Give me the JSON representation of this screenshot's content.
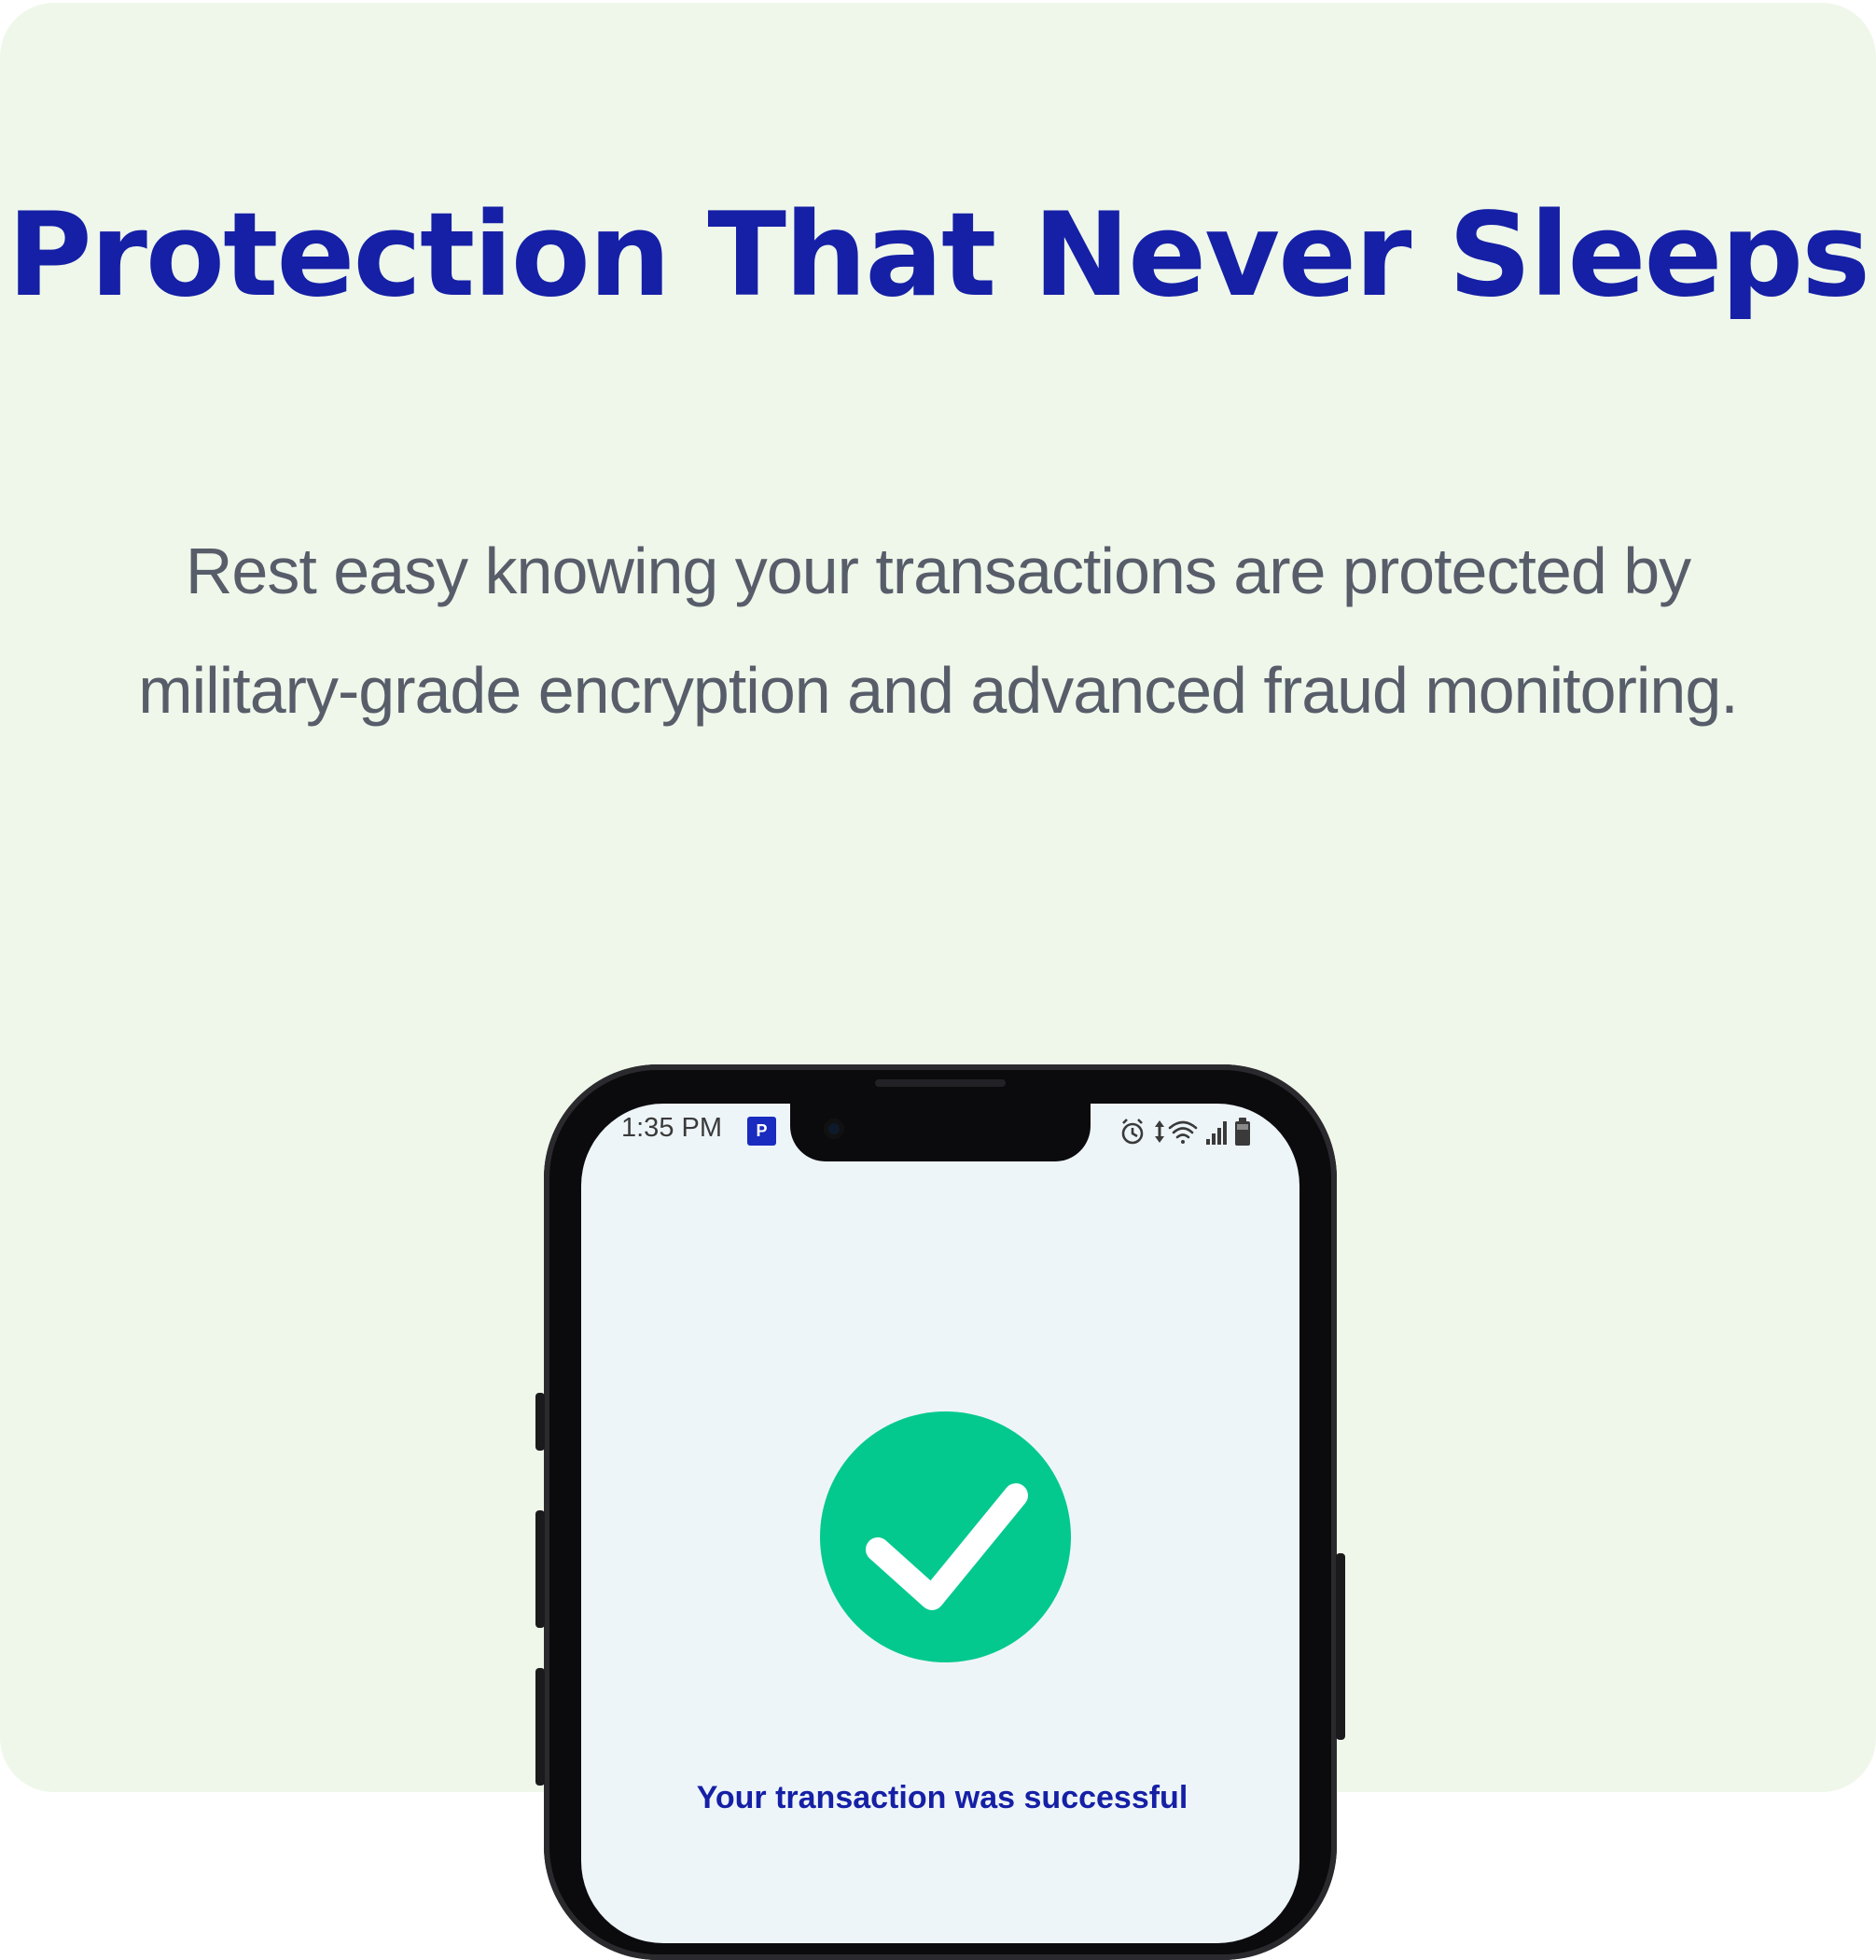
{
  "hero": {
    "title": "Protection That Never Sleeps",
    "description": "Rest easy knowing your transactions are protected by military-grade encryption and advanced fraud monitoring."
  },
  "phone": {
    "status_bar": {
      "time": "1:35 PM",
      "app_badge": "P",
      "icons": [
        "alarm-icon",
        "data-arrows-icon",
        "wifi-icon",
        "signal-icon",
        "battery-icon"
      ]
    },
    "success_icon": "check-circle-icon",
    "success_message": "Your transaction was successful"
  },
  "colors": {
    "background": "#eff7ea",
    "title": "#1520a6",
    "body_text": "#585d6a",
    "success_green": "#04c98e",
    "screen": "#eef5f9"
  }
}
